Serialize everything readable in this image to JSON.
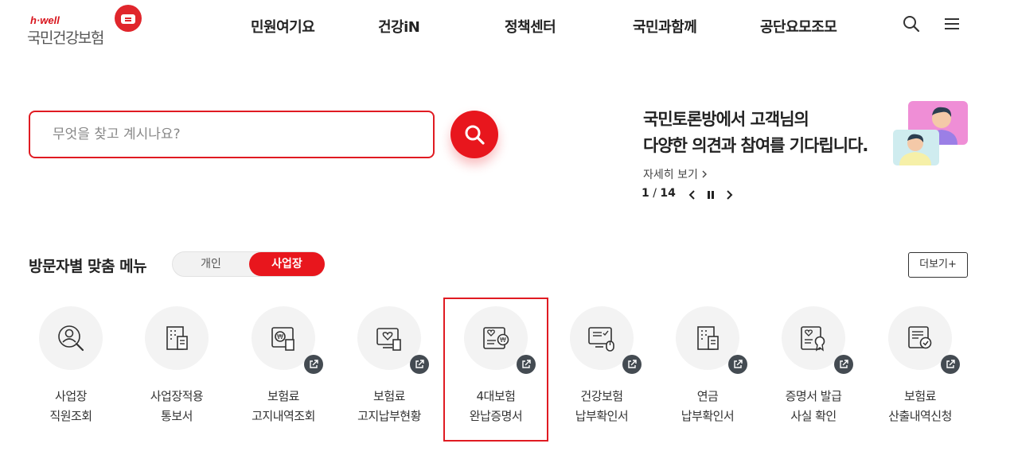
{
  "header": {
    "logo_tagline": "h·well",
    "logo_name": "국민건강보험",
    "nav": [
      "민원여기요",
      "건강iN",
      "정책센터",
      "국민과함께",
      "공단요모조모"
    ],
    "search_icon": "search-icon",
    "menu_icon": "hamburger-menu-icon"
  },
  "search": {
    "placeholder": "무엇을 찾고 계시나요?",
    "button_icon": "search-icon"
  },
  "banner": {
    "line1": "국민토론방에서 고객님의",
    "line2": "다양한 의견과 참여를 기다립니다.",
    "more_label": "자세히 보기",
    "current_page": "1",
    "separator": " / ",
    "total_pages": "14"
  },
  "menu": {
    "title": "방문자별 맞춤 메뉴",
    "toggle": [
      "개인",
      "사업장"
    ],
    "toggle_selected": "사업장",
    "more_label": "더보기+",
    "items": [
      {
        "line1": "사업장",
        "line2": "직원조회",
        "icon": "employee-search-icon",
        "external": false
      },
      {
        "line1": "사업장적용",
        "line2": "통보서",
        "icon": "building-document-icon",
        "external": false
      },
      {
        "line1": "보험료",
        "line2": "고지내역조회",
        "icon": "won-document-icon",
        "external": true
      },
      {
        "line1": "보험료",
        "line2": "고지납부현황",
        "icon": "heart-monitor-document-icon",
        "external": true
      },
      {
        "line1": "4대보험",
        "line2": "완납증명서",
        "icon": "heart-won-document-icon",
        "external": true
      },
      {
        "line1": "건강보험",
        "line2": "납부확인서",
        "icon": "monitor-mouse-icon",
        "external": true
      },
      {
        "line1": "연금",
        "line2": "납부확인서",
        "icon": "building-document-icon",
        "external": true
      },
      {
        "line1": "증명서 발급",
        "line2": "사실 확인",
        "icon": "certificate-icon",
        "external": true
      },
      {
        "line1": "보험료",
        "line2": "산출내역신청",
        "icon": "document-check-icon",
        "external": true
      }
    ],
    "highlighted_item": "4대보험 완납증명서"
  },
  "colors": {
    "brand_red": "#e8161d",
    "dark_badge": "#444b52",
    "icon_bg": "#f3f3f3"
  }
}
